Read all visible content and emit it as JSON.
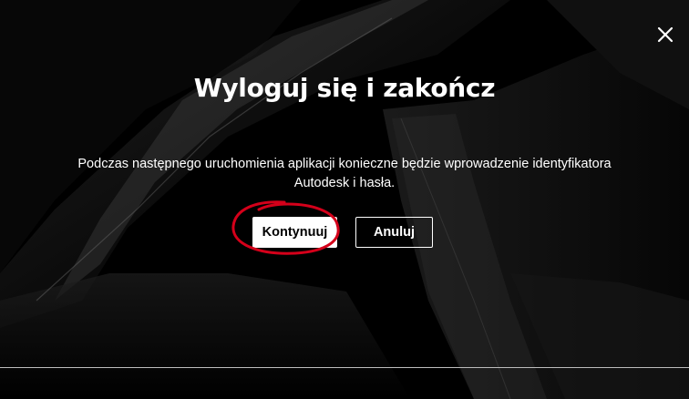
{
  "dialog": {
    "title": "Wyloguj się i zakończ",
    "message_line1": "Podczas następnego uruchomienia aplikacji konieczne będzie wprowadzenie identyfikatora",
    "message_line2": "Autodesk i hasła.",
    "continue_label": "Kontynuuj",
    "cancel_label": "Anuluj"
  },
  "icons": {
    "close": "close-icon"
  },
  "colors": {
    "background": "#000000",
    "text": "#ffffff",
    "primary_button_bg": "#ffffff",
    "primary_button_text": "#000000",
    "annotation": "#d4001a"
  }
}
